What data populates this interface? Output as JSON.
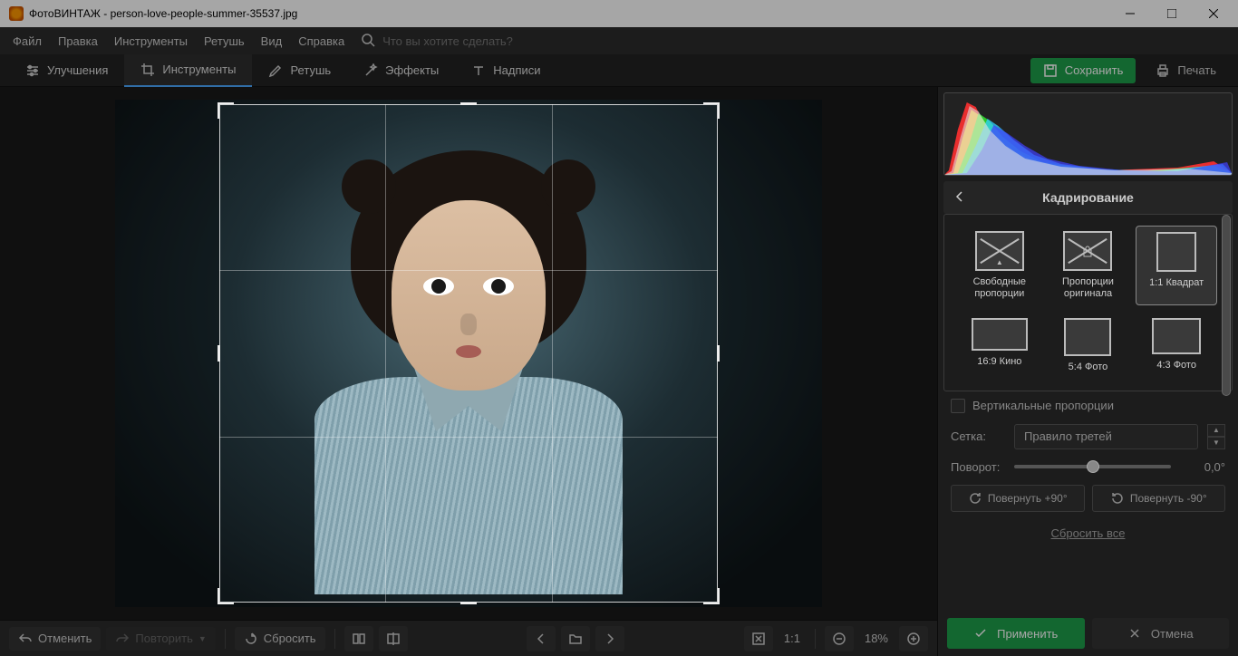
{
  "titlebar": {
    "app": "ФотоВИНТАЖ",
    "file": "person-love-people-summer-35537.jpg"
  },
  "menu": {
    "file": "Файл",
    "edit": "Правка",
    "tools": "Инструменты",
    "retouch": "Ретушь",
    "view": "Вид",
    "help": "Справка",
    "search_placeholder": "Что вы хотите сделать?"
  },
  "tabs": {
    "enhance": "Улучшения",
    "tools": "Инструменты",
    "retouch": "Ретушь",
    "effects": "Эффекты",
    "text": "Надписи"
  },
  "actions": {
    "save": "Сохранить",
    "print": "Печать"
  },
  "bottom": {
    "undo": "Отменить",
    "redo": "Повторить",
    "reset": "Сбросить",
    "ratio": "1:1",
    "zoom": "18%"
  },
  "panel": {
    "title": "Кадрирование",
    "presets": {
      "free": "Свободные пропорции",
      "original": "Пропорции оригинала",
      "square": "1:1 Квадрат",
      "wide": "16:9 Кино",
      "r54": "5:4 Фото",
      "r43": "4:3 Фото"
    },
    "vertical": "Вертикальные пропорции",
    "grid_label": "Сетка:",
    "grid_value": "Правило третей",
    "rotation_label": "Поворот:",
    "rotation_value": "0,0°",
    "rotate_cw": "Повернуть +90°",
    "rotate_ccw": "Повернуть -90°",
    "reset_all": "Сбросить все",
    "apply": "Применить",
    "cancel": "Отмена"
  }
}
